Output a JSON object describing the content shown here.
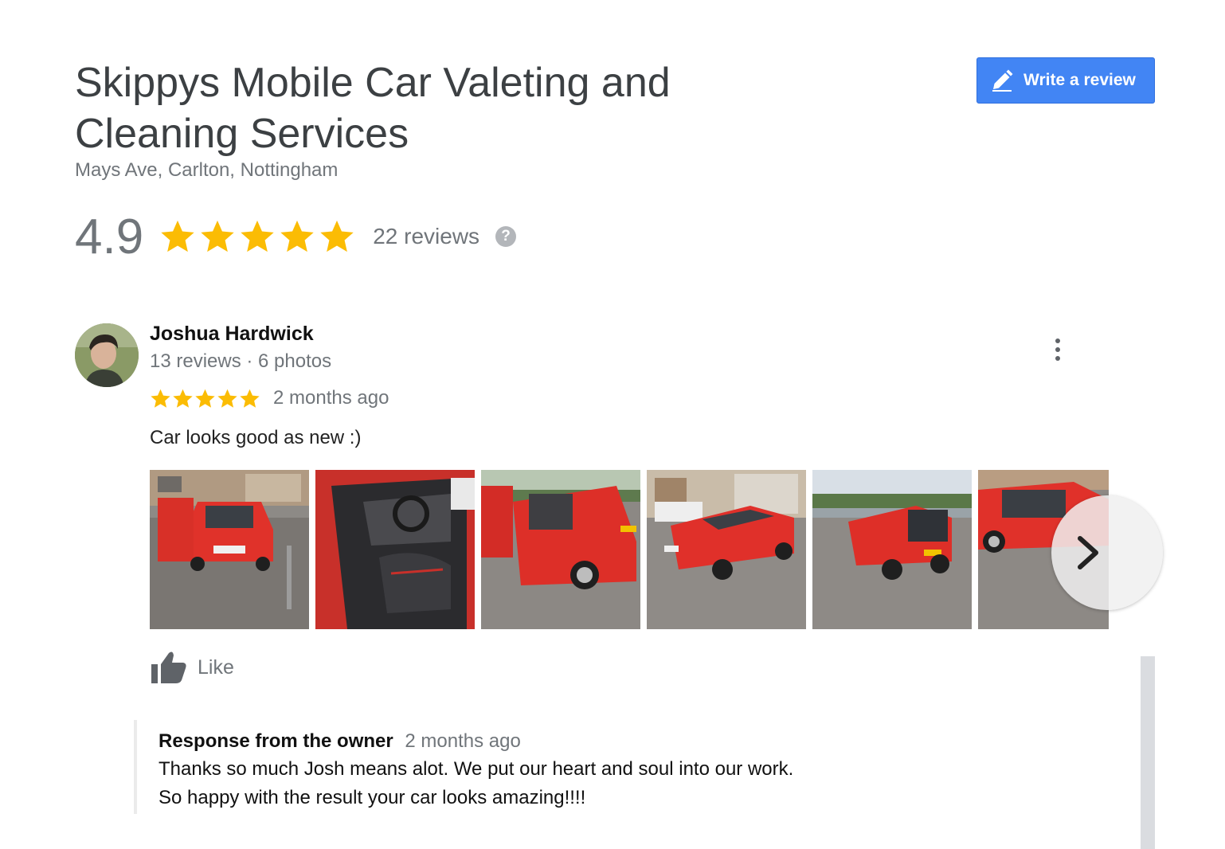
{
  "business": {
    "name": "Skippys Mobile Car Valeting and Cleaning Services",
    "address": "Mays Ave, Carlton, Nottingham"
  },
  "actions": {
    "write_review_label": "Write a review",
    "write_review_icon": "pencil-icon"
  },
  "rating": {
    "score": "4.9",
    "stars": 5,
    "reviews_count": "22 reviews",
    "help_glyph": "?"
  },
  "review": {
    "reviewer_name": "Joshua Hardwick",
    "reviewer_meta": "13 reviews · 6 photos",
    "stars": 5,
    "time": "2 months ago",
    "text": "Car looks good as new :)",
    "photos": [
      "red-car-front",
      "red-car-interior",
      "red-car-open-door",
      "red-car-three-quarter",
      "red-car-rear",
      "red-car-side"
    ],
    "like_label": "Like"
  },
  "owner_response": {
    "by": "Response from the owner",
    "time": "2 months ago",
    "line1": "Thanks so much Josh means alot. We put our heart and soul into our work.",
    "line2": "So happy with the result your car looks amazing!!!!"
  },
  "colors": {
    "accent_blue": "#4285f4",
    "star_yellow": "#fbbc04",
    "secondary_text": "#70757a"
  }
}
